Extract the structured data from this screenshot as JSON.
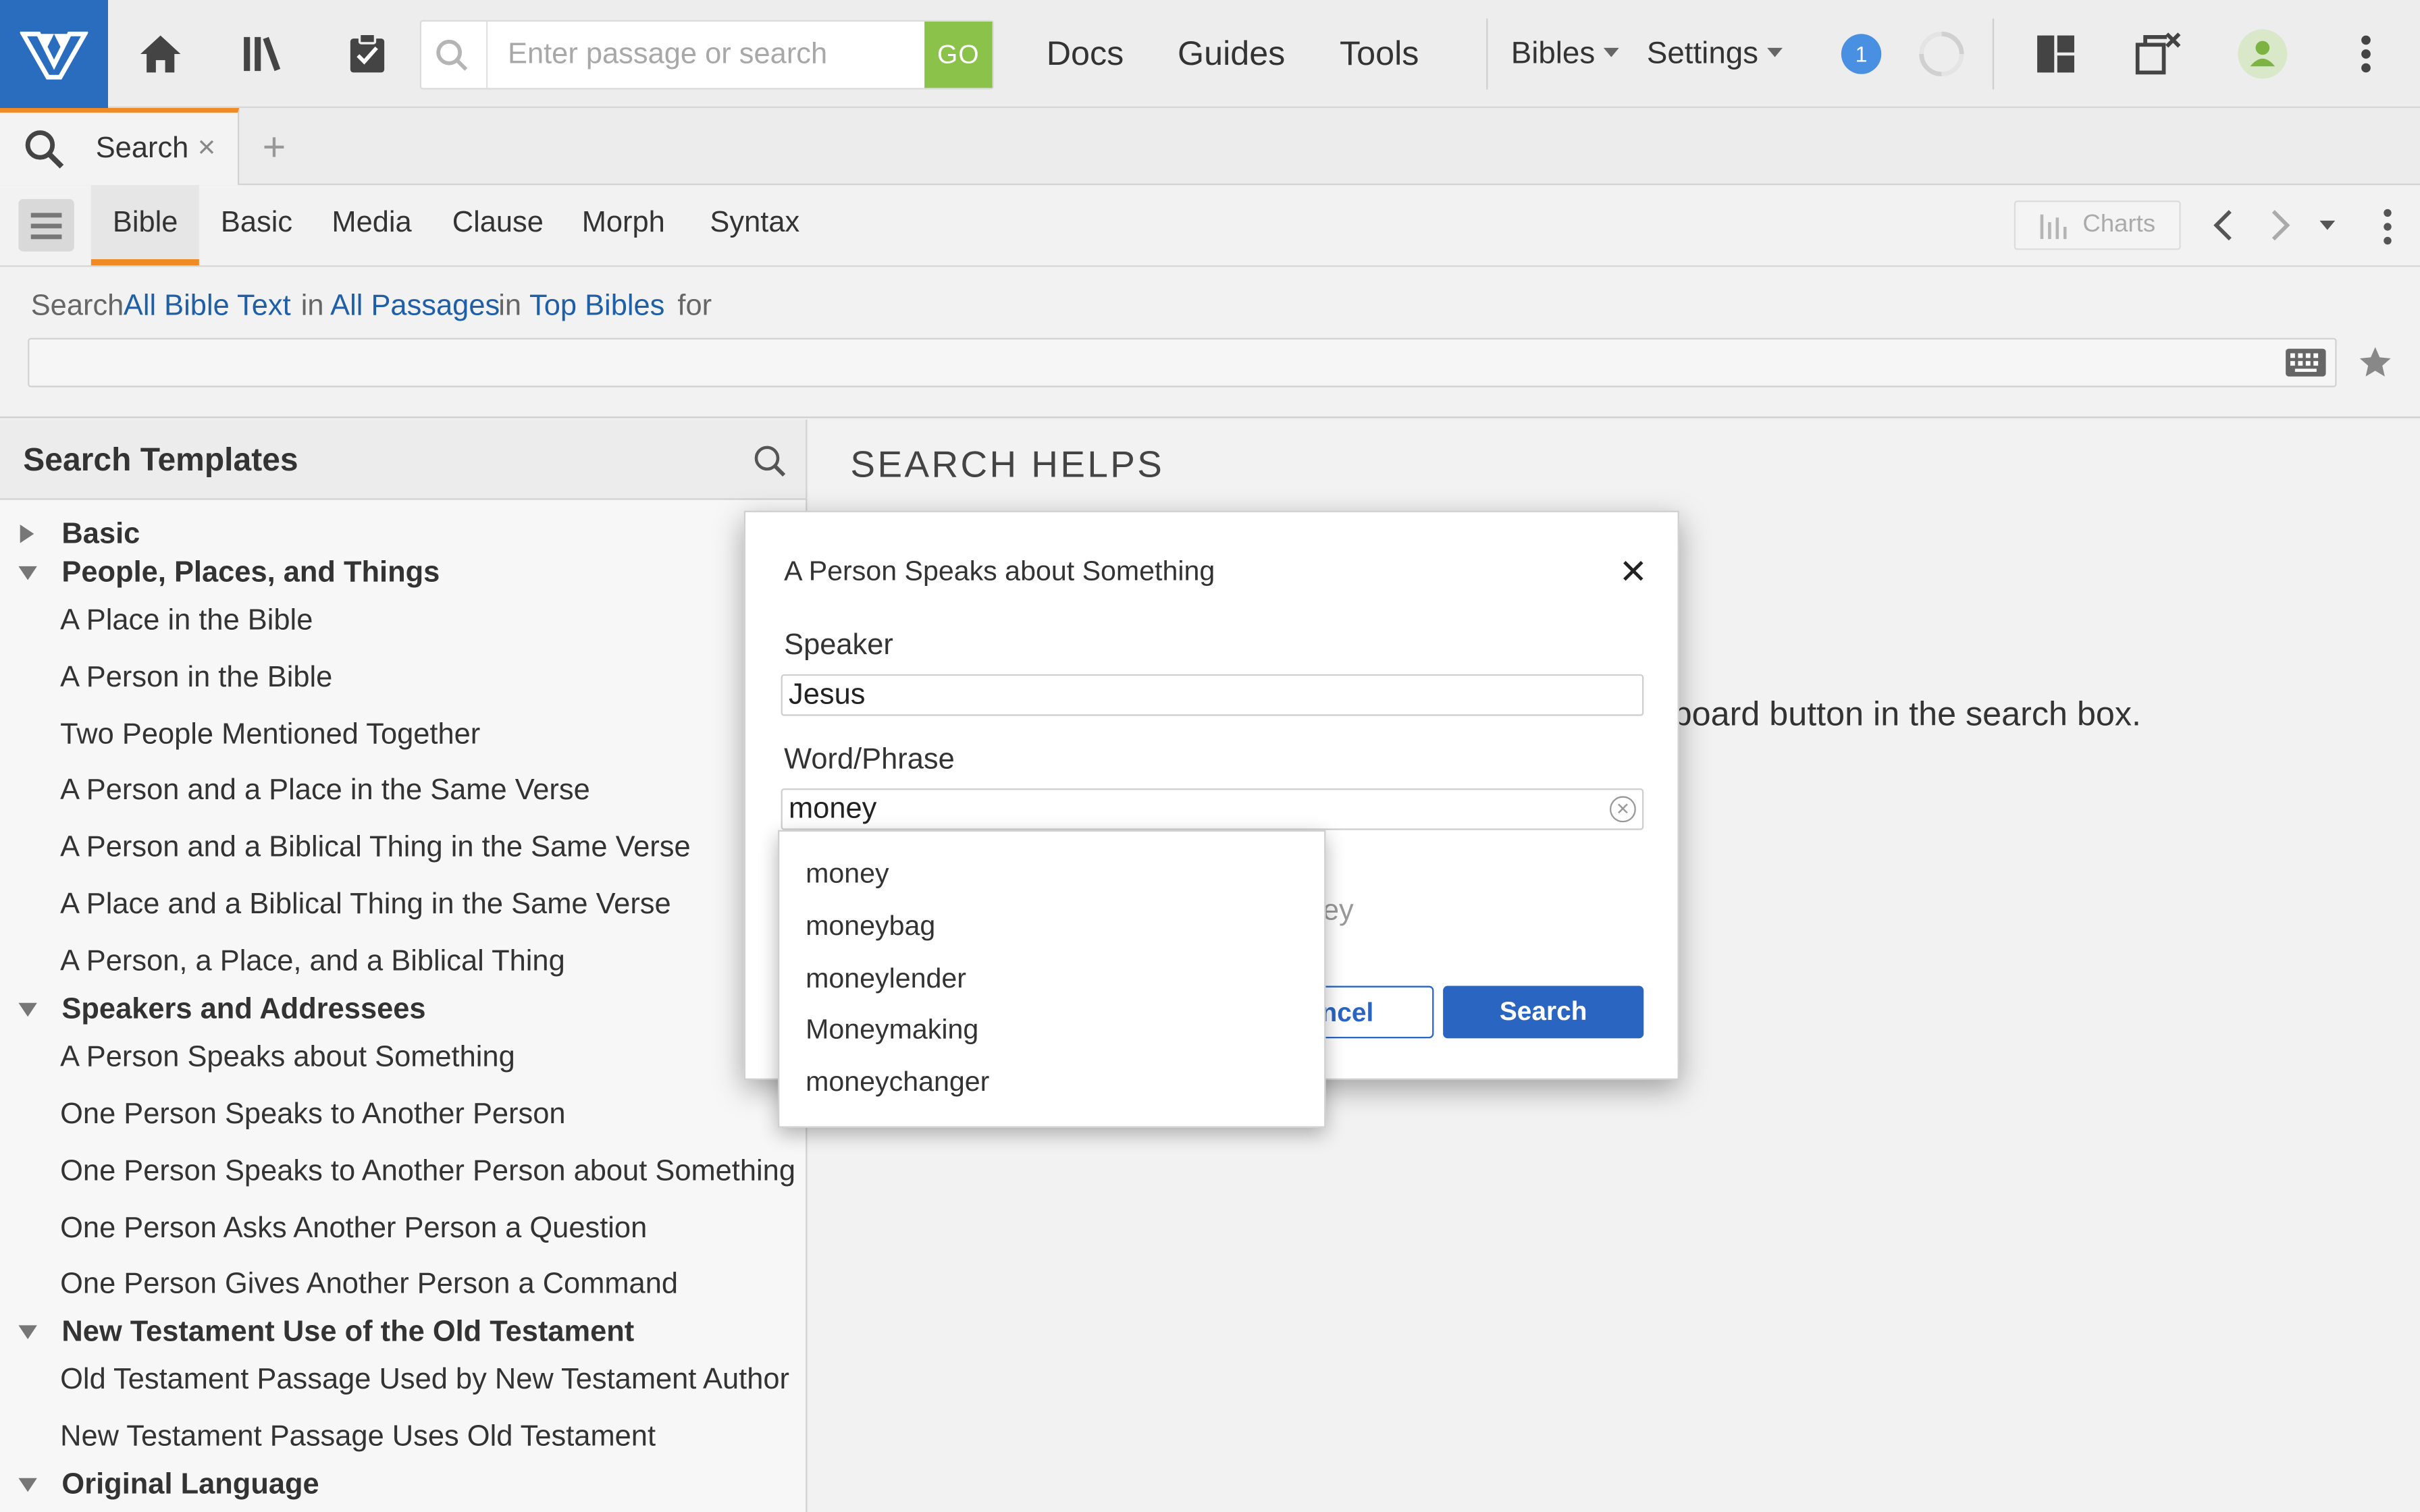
{
  "topbar": {
    "search_placeholder": "Enter passage or search",
    "go_label": "GO",
    "nav": [
      "Docs",
      "Guides",
      "Tools"
    ],
    "bibles_label": "Bibles",
    "settings_label": "Settings",
    "notification_count": "1"
  },
  "tabs": [
    {
      "label": "Search",
      "close": "×"
    }
  ],
  "add_tab": "+",
  "toolbar": {
    "subtabs": [
      "Bible",
      "Basic",
      "Media",
      "Clause",
      "Morph",
      "Syntax"
    ],
    "charts_label": "Charts"
  },
  "searchline": {
    "word_search": "Search",
    "scope": "All Bible Text",
    "in1": "in",
    "passages": "All Passages",
    "in2": "in",
    "bibles": "Top Bibles",
    "for": "for"
  },
  "templates": {
    "title": "Search Templates",
    "rows": [
      {
        "label": "Basic",
        "group": true,
        "expanded": false
      },
      {
        "label": "People, Places, and Things",
        "group": true,
        "expanded": true
      },
      {
        "label": "A Place in the Bible",
        "group": false
      },
      {
        "label": "A Person in the Bible",
        "group": false
      },
      {
        "label": "Two People Mentioned Together",
        "group": false
      },
      {
        "label": "A Person and a Place in the Same Verse",
        "group": false
      },
      {
        "label": "A Person and a Biblical Thing in the Same Verse",
        "group": false
      },
      {
        "label": "A Place and a Biblical Thing in the Same Verse",
        "group": false
      },
      {
        "label": "A Person, a Place, and a Biblical Thing",
        "group": false
      },
      {
        "label": "Speakers and Addressees",
        "group": true,
        "expanded": true
      },
      {
        "label": "A Person Speaks about Something",
        "group": false
      },
      {
        "label": "One Person Speaks to Another Person",
        "group": false
      },
      {
        "label": "One Person Speaks to Another Person about Something",
        "group": false
      },
      {
        "label": "One Person Asks Another Person a Question",
        "group": false
      },
      {
        "label": "One Person Gives Another Person a Command",
        "group": false
      },
      {
        "label": "New Testament Use of the Old Testament",
        "group": true,
        "expanded": true
      },
      {
        "label": "Old Testament Passage Used by New Testament Author",
        "group": false
      },
      {
        "label": "New Testament Passage Uses Old Testament",
        "group": false
      },
      {
        "label": "Original Language",
        "group": true,
        "expanded": true
      }
    ]
  },
  "helps": {
    "title": "SEARCH HELPS",
    "visible_text": "board button in the search box."
  },
  "dialog": {
    "title": "A Person Speaks about Something",
    "close": "✕",
    "speaker_label": "Speaker",
    "speaker_value": "Jesus",
    "word_label": "Word/Phrase",
    "word_value": "money",
    "partial_text": "ey",
    "cancel_label": "ncel",
    "search_label": "Search"
  },
  "autocomplete": [
    "money",
    "moneybag",
    "moneylender",
    "Moneymaking",
    "moneychanger"
  ],
  "colors": {
    "brand": "#2a6dbf",
    "go": "#8bc34a",
    "accent_orange": "#f08a24",
    "link": "#1f5fa8",
    "primary_button": "#2a65c2"
  }
}
